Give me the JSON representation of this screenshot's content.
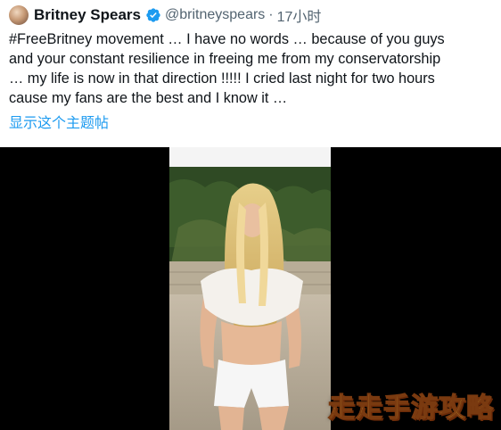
{
  "tweet": {
    "author": {
      "display_name": "Britney Spears",
      "verified": true,
      "handle": "@britneyspears",
      "separator": "·",
      "timestamp": "17小时"
    },
    "text_lines": [
      "#FreeBritney movement … I have no words … because of you guys",
      "and your constant resilience in freeing me from my conservatorship",
      "… my life is now in that direction !!!!! I cried last night for two hours",
      "cause my fans are the best and I know it …"
    ],
    "translate_link": "显示这个主题帖",
    "media": {
      "type": "photo"
    }
  },
  "watermark": "走走手游攻略",
  "colors": {
    "text": "#0f1419",
    "secondary": "#536471",
    "link": "#1d9bf0",
    "media_background": "#000000",
    "watermark": "#f6d245"
  }
}
